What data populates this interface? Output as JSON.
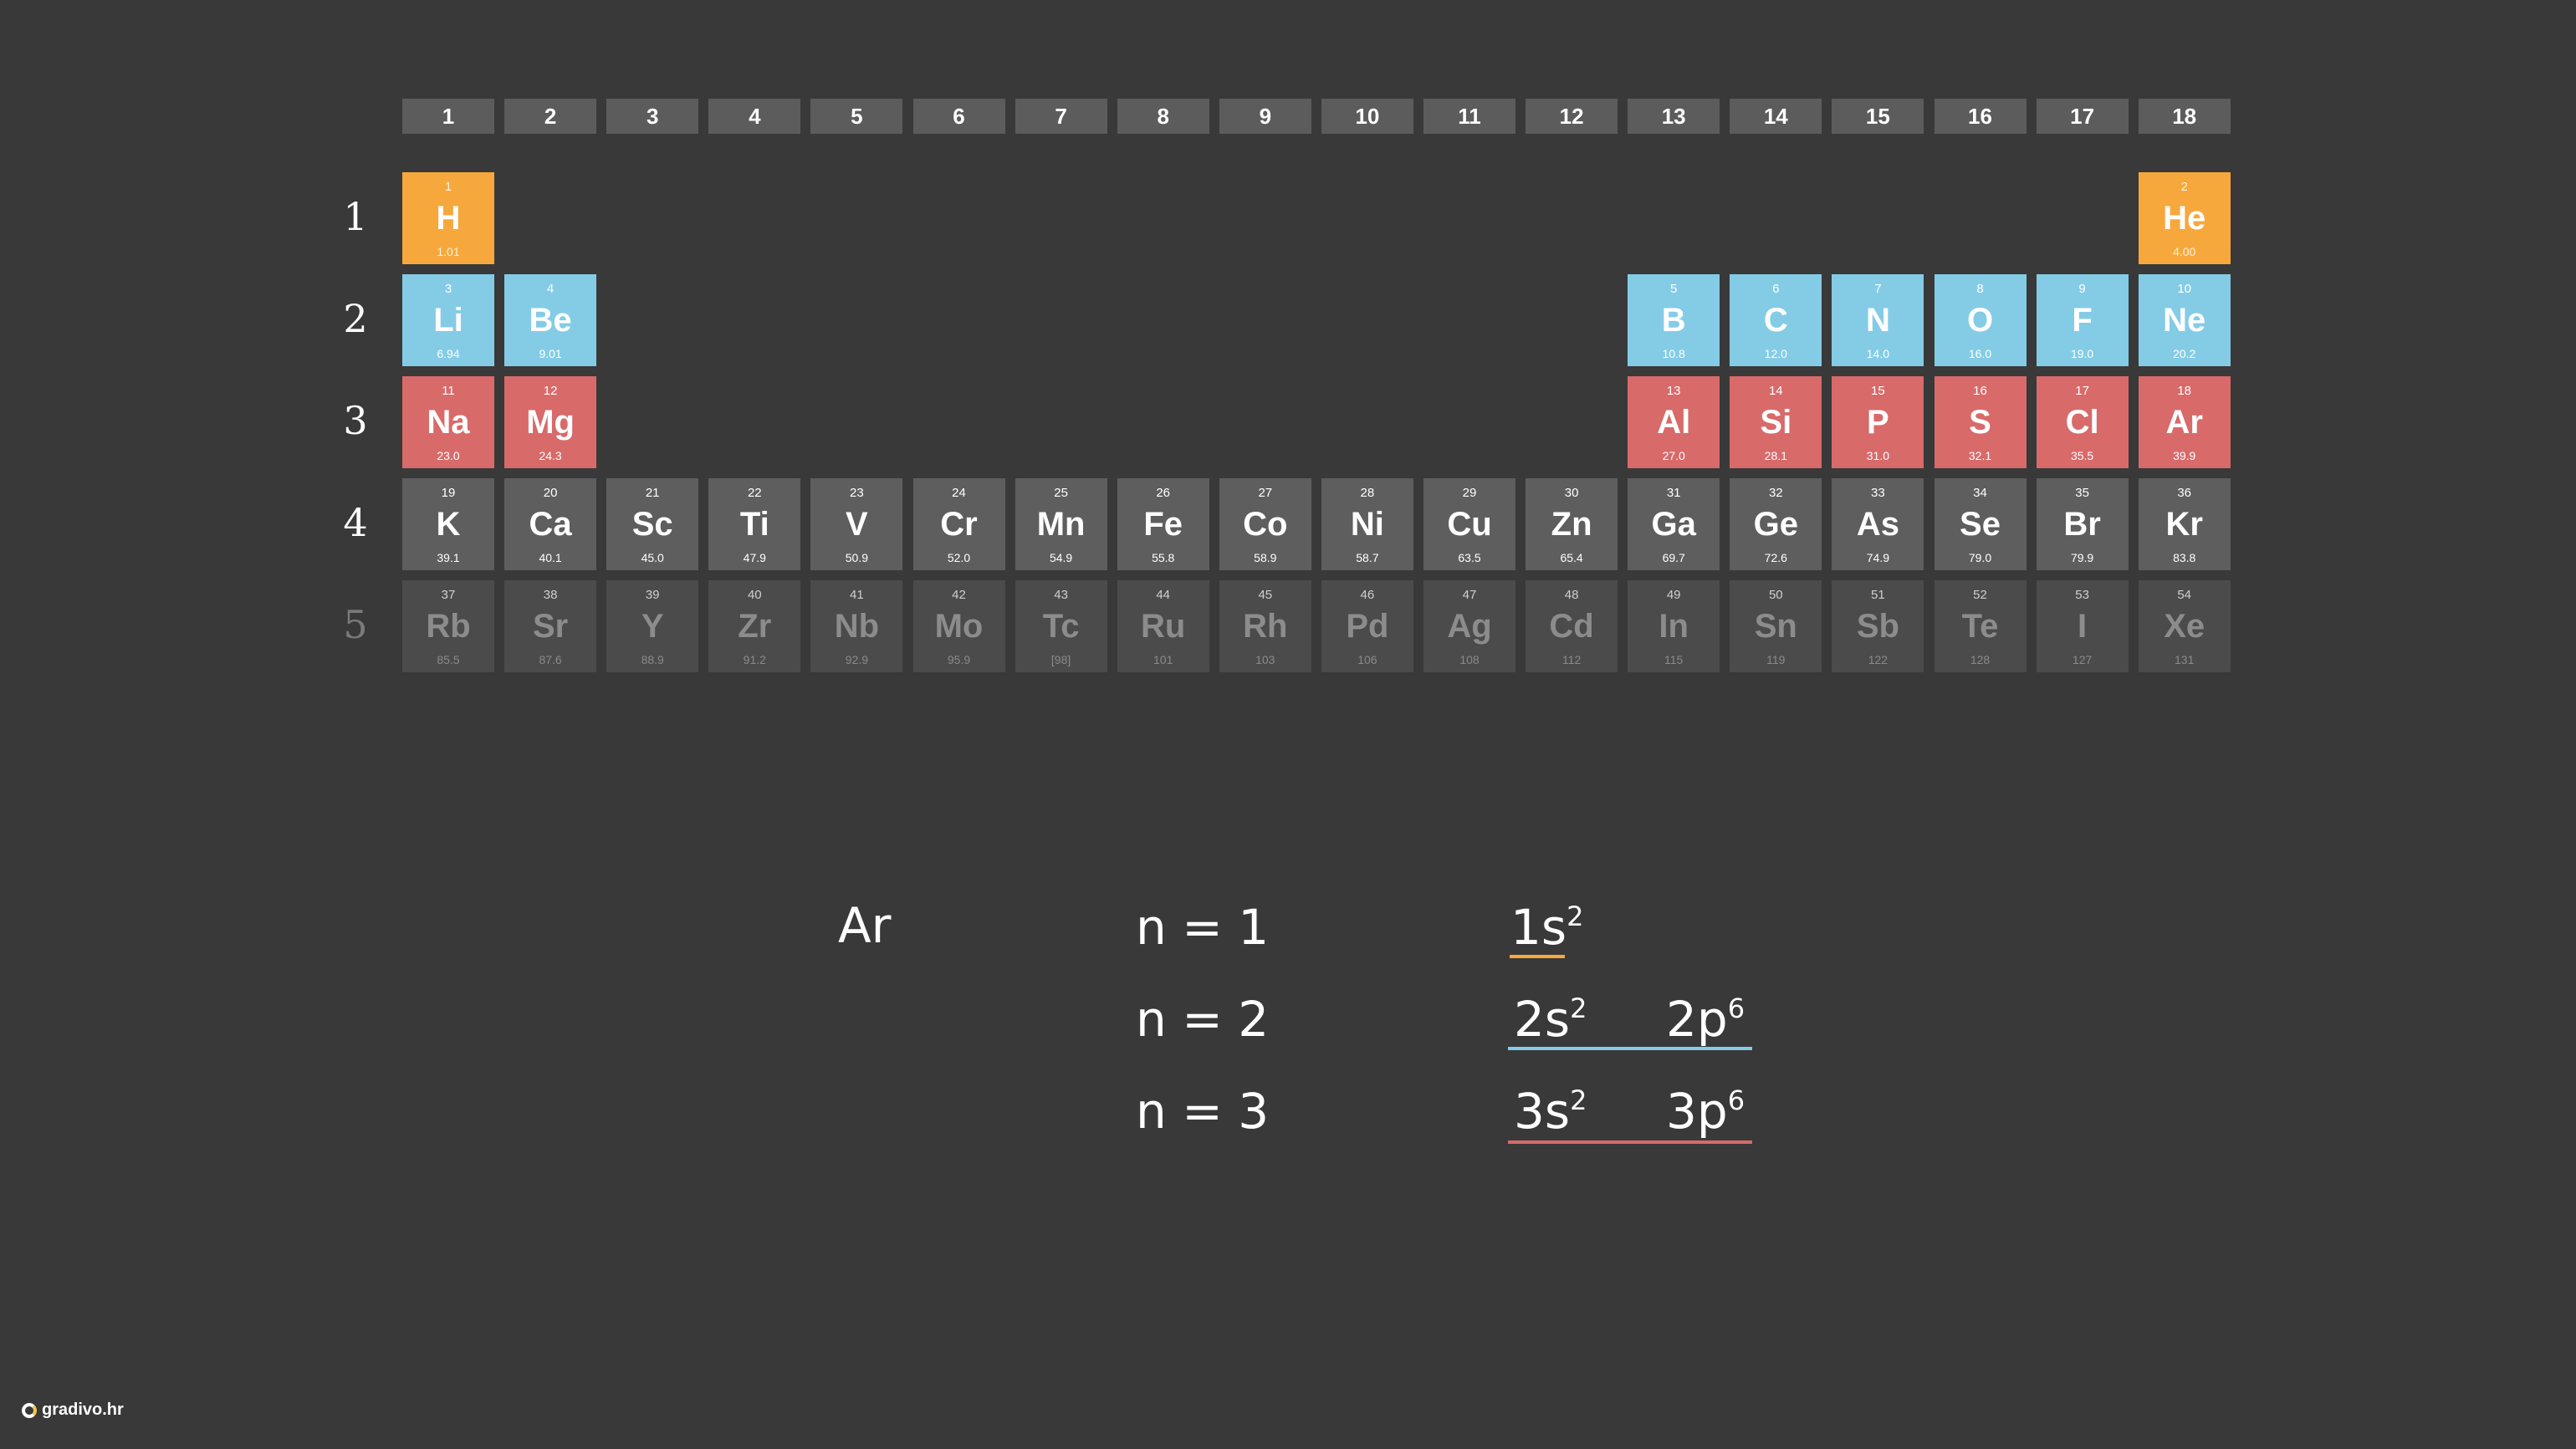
{
  "groups": [
    "1",
    "2",
    "3",
    "4",
    "5",
    "6",
    "7",
    "8",
    "9",
    "10",
    "11",
    "12",
    "13",
    "14",
    "15",
    "16",
    "17",
    "18"
  ],
  "periods": [
    "1",
    "2",
    "3",
    "4",
    "5"
  ],
  "elements": [
    {
      "num": "1",
      "sym": "H",
      "mass": "1.01",
      "g": 1,
      "p": 1,
      "c": "orange"
    },
    {
      "num": "2",
      "sym": "He",
      "mass": "4.00",
      "g": 18,
      "p": 1,
      "c": "orange"
    },
    {
      "num": "3",
      "sym": "Li",
      "mass": "6.94",
      "g": 1,
      "p": 2,
      "c": "blue"
    },
    {
      "num": "4",
      "sym": "Be",
      "mass": "9.01",
      "g": 2,
      "p": 2,
      "c": "blue"
    },
    {
      "num": "5",
      "sym": "B",
      "mass": "10.8",
      "g": 13,
      "p": 2,
      "c": "blue"
    },
    {
      "num": "6",
      "sym": "C",
      "mass": "12.0",
      "g": 14,
      "p": 2,
      "c": "blue"
    },
    {
      "num": "7",
      "sym": "N",
      "mass": "14.0",
      "g": 15,
      "p": 2,
      "c": "blue"
    },
    {
      "num": "8",
      "sym": "O",
      "mass": "16.0",
      "g": 16,
      "p": 2,
      "c": "blue"
    },
    {
      "num": "9",
      "sym": "F",
      "mass": "19.0",
      "g": 17,
      "p": 2,
      "c": "blue"
    },
    {
      "num": "10",
      "sym": "Ne",
      "mass": "20.2",
      "g": 18,
      "p": 2,
      "c": "blue"
    },
    {
      "num": "11",
      "sym": "Na",
      "mass": "23.0",
      "g": 1,
      "p": 3,
      "c": "red"
    },
    {
      "num": "12",
      "sym": "Mg",
      "mass": "24.3",
      "g": 2,
      "p": 3,
      "c": "red"
    },
    {
      "num": "13",
      "sym": "Al",
      "mass": "27.0",
      "g": 13,
      "p": 3,
      "c": "red"
    },
    {
      "num": "14",
      "sym": "Si",
      "mass": "28.1",
      "g": 14,
      "p": 3,
      "c": "red"
    },
    {
      "num": "15",
      "sym": "P",
      "mass": "31.0",
      "g": 15,
      "p": 3,
      "c": "red"
    },
    {
      "num": "16",
      "sym": "S",
      "mass": "32.1",
      "g": 16,
      "p": 3,
      "c": "red"
    },
    {
      "num": "17",
      "sym": "Cl",
      "mass": "35.5",
      "g": 17,
      "p": 3,
      "c": "red"
    },
    {
      "num": "18",
      "sym": "Ar",
      "mass": "39.9",
      "g": 18,
      "p": 3,
      "c": "red"
    },
    {
      "num": "19",
      "sym": "K",
      "mass": "39.1",
      "g": 1,
      "p": 4,
      "c": "gray"
    },
    {
      "num": "20",
      "sym": "Ca",
      "mass": "40.1",
      "g": 2,
      "p": 4,
      "c": "gray"
    },
    {
      "num": "21",
      "sym": "Sc",
      "mass": "45.0",
      "g": 3,
      "p": 4,
      "c": "gray"
    },
    {
      "num": "22",
      "sym": "Ti",
      "mass": "47.9",
      "g": 4,
      "p": 4,
      "c": "gray"
    },
    {
      "num": "23",
      "sym": "V",
      "mass": "50.9",
      "g": 5,
      "p": 4,
      "c": "gray"
    },
    {
      "num": "24",
      "sym": "Cr",
      "mass": "52.0",
      "g": 6,
      "p": 4,
      "c": "gray"
    },
    {
      "num": "25",
      "sym": "Mn",
      "mass": "54.9",
      "g": 7,
      "p": 4,
      "c": "gray"
    },
    {
      "num": "26",
      "sym": "Fe",
      "mass": "55.8",
      "g": 8,
      "p": 4,
      "c": "gray"
    },
    {
      "num": "27",
      "sym": "Co",
      "mass": "58.9",
      "g": 9,
      "p": 4,
      "c": "gray"
    },
    {
      "num": "28",
      "sym": "Ni",
      "mass": "58.7",
      "g": 10,
      "p": 4,
      "c": "gray"
    },
    {
      "num": "29",
      "sym": "Cu",
      "mass": "63.5",
      "g": 11,
      "p": 4,
      "c": "gray"
    },
    {
      "num": "30",
      "sym": "Zn",
      "mass": "65.4",
      "g": 12,
      "p": 4,
      "c": "gray"
    },
    {
      "num": "31",
      "sym": "Ga",
      "mass": "69.7",
      "g": 13,
      "p": 4,
      "c": "gray"
    },
    {
      "num": "32",
      "sym": "Ge",
      "mass": "72.6",
      "g": 14,
      "p": 4,
      "c": "gray"
    },
    {
      "num": "33",
      "sym": "As",
      "mass": "74.9",
      "g": 15,
      "p": 4,
      "c": "gray"
    },
    {
      "num": "34",
      "sym": "Se",
      "mass": "79.0",
      "g": 16,
      "p": 4,
      "c": "gray"
    },
    {
      "num": "35",
      "sym": "Br",
      "mass": "79.9",
      "g": 17,
      "p": 4,
      "c": "gray"
    },
    {
      "num": "36",
      "sym": "Kr",
      "mass": "83.8",
      "g": 18,
      "p": 4,
      "c": "gray"
    },
    {
      "num": "37",
      "sym": "Rb",
      "mass": "85.5",
      "g": 1,
      "p": 5,
      "c": "dim"
    },
    {
      "num": "38",
      "sym": "Sr",
      "mass": "87.6",
      "g": 2,
      "p": 5,
      "c": "dim"
    },
    {
      "num": "39",
      "sym": "Y",
      "mass": "88.9",
      "g": 3,
      "p": 5,
      "c": "dim"
    },
    {
      "num": "40",
      "sym": "Zr",
      "mass": "91.2",
      "g": 4,
      "p": 5,
      "c": "dim"
    },
    {
      "num": "41",
      "sym": "Nb",
      "mass": "92.9",
      "g": 5,
      "p": 5,
      "c": "dim"
    },
    {
      "num": "42",
      "sym": "Mo",
      "mass": "95.9",
      "g": 6,
      "p": 5,
      "c": "dim"
    },
    {
      "num": "43",
      "sym": "Tc",
      "mass": "[98]",
      "g": 7,
      "p": 5,
      "c": "dim"
    },
    {
      "num": "44",
      "sym": "Ru",
      "mass": "101",
      "g": 8,
      "p": 5,
      "c": "dim"
    },
    {
      "num": "45",
      "sym": "Rh",
      "mass": "103",
      "g": 9,
      "p": 5,
      "c": "dim"
    },
    {
      "num": "46",
      "sym": "Pd",
      "mass": "106",
      "g": 10,
      "p": 5,
      "c": "dim"
    },
    {
      "num": "47",
      "sym": "Ag",
      "mass": "108",
      "g": 11,
      "p": 5,
      "c": "dim"
    },
    {
      "num": "48",
      "sym": "Cd",
      "mass": "112",
      "g": 12,
      "p": 5,
      "c": "dim"
    },
    {
      "num": "49",
      "sym": "In",
      "mass": "115",
      "g": 13,
      "p": 5,
      "c": "dim"
    },
    {
      "num": "50",
      "sym": "Sn",
      "mass": "119",
      "g": 14,
      "p": 5,
      "c": "dim"
    },
    {
      "num": "51",
      "sym": "Sb",
      "mass": "122",
      "g": 15,
      "p": 5,
      "c": "dim"
    },
    {
      "num": "52",
      "sym": "Te",
      "mass": "128",
      "g": 16,
      "p": 5,
      "c": "dim"
    },
    {
      "num": "53",
      "sym": "I",
      "mass": "127",
      "g": 17,
      "p": 5,
      "c": "dim"
    },
    {
      "num": "54",
      "sym": "Xe",
      "mass": "131",
      "g": 18,
      "p": 5,
      "c": "dim"
    }
  ],
  "notes": {
    "element": "Ar",
    "shells": [
      "n = 1",
      "n = 2",
      "n = 3"
    ],
    "orbitals": {
      "s1": "1s",
      "s1_sup": "2",
      "s2": "2s",
      "s2_sup": "2",
      "p2": "2p",
      "p2_sup": "6",
      "s3": "3s",
      "s3_sup": "2",
      "p3": "3p",
      "p3_sup": "6"
    }
  },
  "colors": {
    "shell1_line": "#f7a83c",
    "shell2_line": "#84cce6",
    "shell3_line": "#d86a6a"
  },
  "logo": {
    "text": "gradivo.hr",
    "icon": "gradivo-logo-icon"
  }
}
